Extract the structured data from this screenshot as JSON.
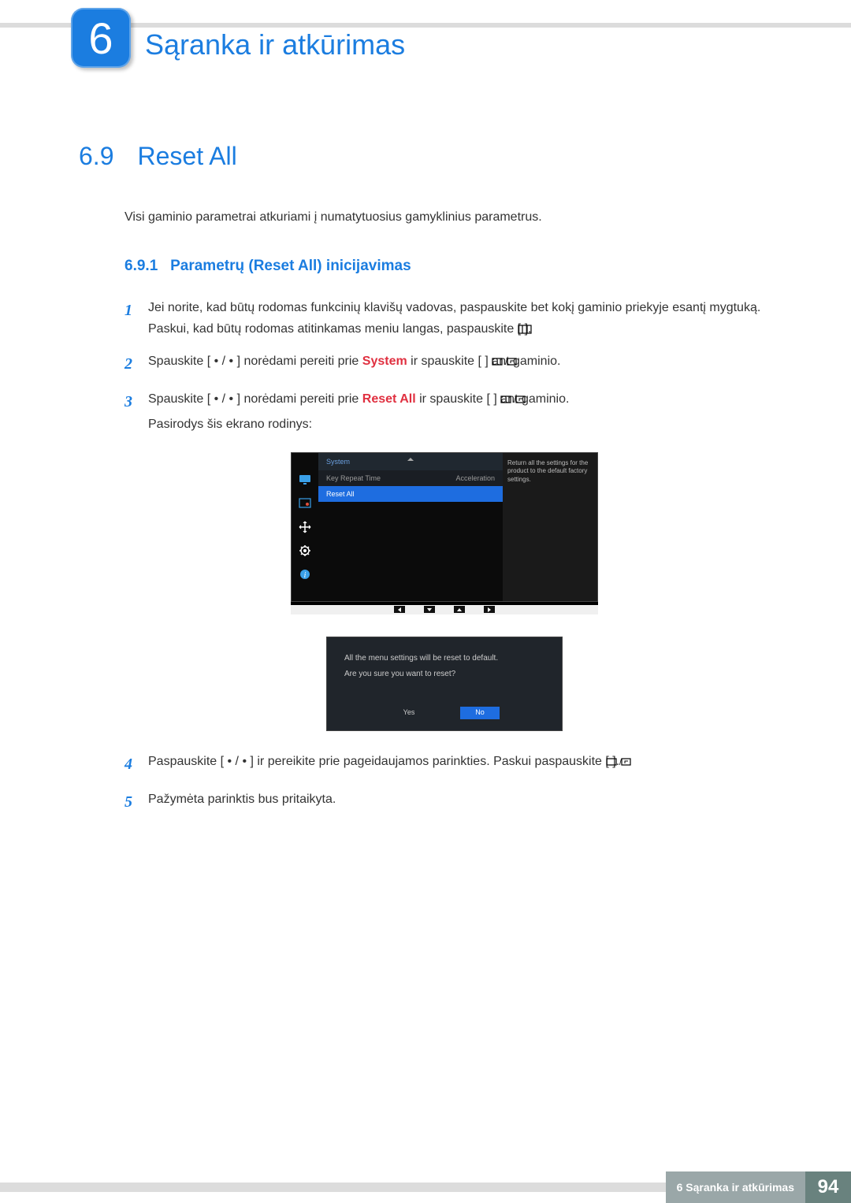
{
  "chapter": {
    "number": "6",
    "title": "Sąranka ir atkūrimas"
  },
  "section": {
    "number": "6.9",
    "title": "Reset All"
  },
  "intro": "Visi gaminio parametrai atkuriami į numatytuosius gamyklinius parametrus.",
  "subsection": {
    "number": "6.9.1",
    "title": "Parametrų (Reset All) inicijavimas"
  },
  "steps": {
    "s1": {
      "n": "1",
      "text": "Jei norite, kad būtų rodomas funkcinių klavišų vadovas, paspauskite bet kokį gaminio priekyje esantį mygtuką. Paskui, kad būtų rodomas atitinkamas meniu langas, paspauskite [  ]."
    },
    "s2": {
      "n": "2",
      "pre": "Spauskite [ • / • ] norėdami pereiti prie ",
      "kw": "System",
      "post": " ir spauskite [  ] ant gaminio."
    },
    "s3": {
      "n": "3",
      "pre": "Spauskite [ • / • ] norėdami pereiti prie ",
      "kw": "Reset All",
      "post": " ir spauskite [  ] ant gaminio.",
      "tail": "Pasirodys šis ekrano rodinys:"
    },
    "s4": {
      "n": "4",
      "text": "Paspauskite [ • / • ] ir pereikite prie pageidaujamos parinkties. Paskui paspauskite [  ]."
    },
    "s5": {
      "n": "5",
      "text": "Pažymėta parinktis bus pritaikyta."
    }
  },
  "osd": {
    "header": "System",
    "row1": {
      "label": "Key Repeat Time",
      "value": "Acceleration"
    },
    "row2": {
      "label": "Reset All"
    },
    "info": "Return all the settings for the product to the default factory settings.",
    "dialog": {
      "line1": "All the menu settings will be reset to default.",
      "line2": "Are you sure you want to reset?",
      "yes": "Yes",
      "no": "No"
    }
  },
  "footer": {
    "label": "6 Sąranka ir atkūrimas",
    "page": "94"
  }
}
